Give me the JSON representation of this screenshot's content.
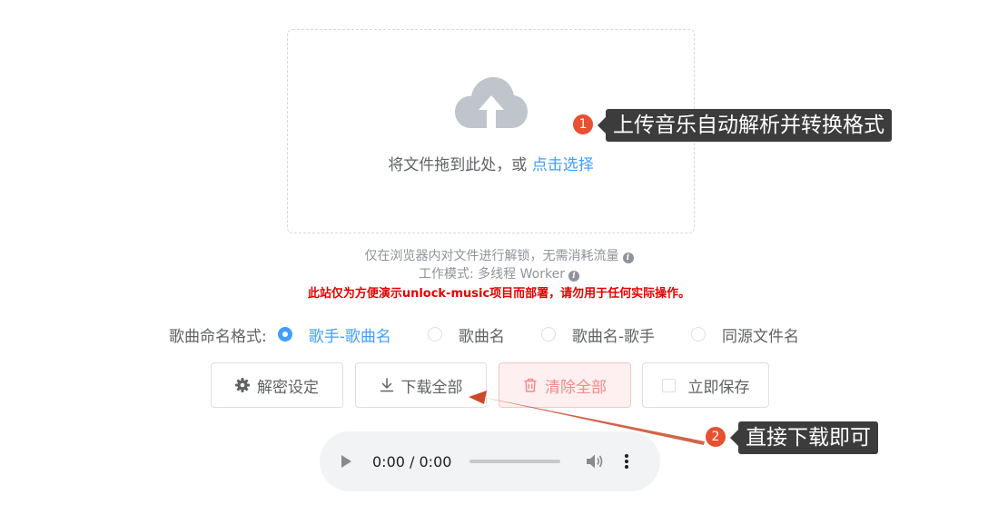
{
  "upload": {
    "prompt": "将文件拖到此处，或 ",
    "link": "点击选择",
    "icon": "cloud-upload-icon"
  },
  "tips": {
    "line1": "仅在浏览器内对文件进行解锁，无需消耗流量",
    "line2": "工作模式: 多线程 Worker",
    "info_icon": "i",
    "warning": "此站仅为方便演示unlock-music项目而部署，请勿用于任何实际操作。"
  },
  "naming": {
    "label": "歌曲命名格式:",
    "options": [
      {
        "label": "歌手-歌曲名",
        "checked": true
      },
      {
        "label": "歌曲名",
        "checked": false
      },
      {
        "label": "歌曲名-歌手",
        "checked": false
      },
      {
        "label": "同源文件名",
        "checked": false
      }
    ]
  },
  "buttons": {
    "settings": "解密设定",
    "download_all": "下载全部",
    "clear_all": "清除全部",
    "save_now": "立即保存"
  },
  "audio": {
    "time": "0:00 / 0:00"
  },
  "annotations": {
    "badge1": "1",
    "callout1": "上传音乐自动解析并转换格式",
    "badge2": "2",
    "callout2": "直接下载即可"
  },
  "colors": {
    "accent": "#409eff",
    "danger": "#f78989",
    "warning_text": "#e60000",
    "badge": "#e8502f",
    "callout_bg": "#3c3c3c"
  }
}
